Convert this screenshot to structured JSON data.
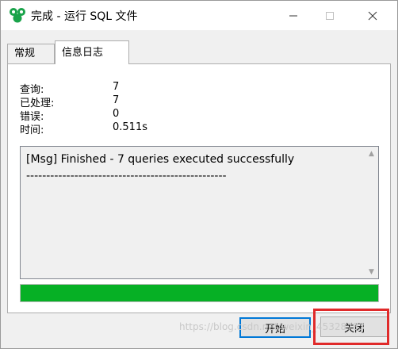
{
  "window": {
    "title": "完成 - 运行 SQL 文件"
  },
  "tabs": [
    {
      "label": "常规",
      "active": false
    },
    {
      "label": "信息日志",
      "active": true
    }
  ],
  "stats": [
    {
      "label": "查询:",
      "value": "7"
    },
    {
      "label": "已处理:",
      "value": "7"
    },
    {
      "label": "错误:",
      "value": "0"
    },
    {
      "label": "时间:",
      "value": "0.511s"
    }
  ],
  "log": {
    "lines": [
      "[Msg] Finished - 7 queries executed successfully",
      "--------------------------------------------------"
    ]
  },
  "progress": {
    "percent": 100,
    "color": "#06b025"
  },
  "buttons": {
    "start": "开始",
    "close": "关闭"
  },
  "watermark": "https://blog.csdn.net/weixin_45328783",
  "icons": {
    "app": "navicat-leaf-icon",
    "minimize": "minimize-icon",
    "maximize": "maximize-icon",
    "close": "close-icon"
  }
}
